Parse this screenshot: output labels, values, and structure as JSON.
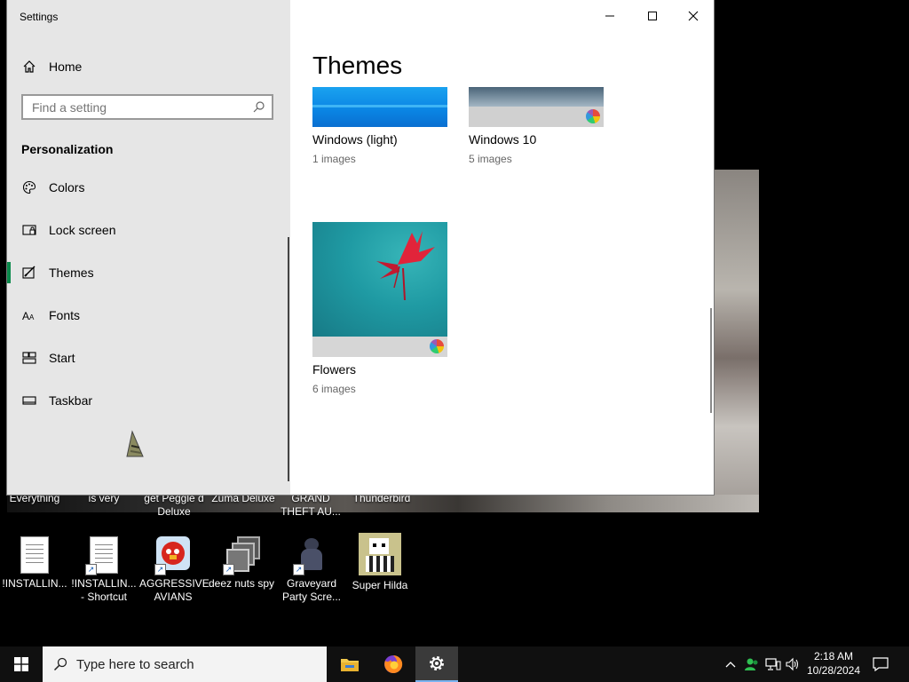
{
  "window": {
    "title": "Settings",
    "heading": "Themes"
  },
  "nav": {
    "home": "Home",
    "search_placeholder": "Find a setting",
    "section": "Personalization",
    "items": [
      {
        "label": "Colors",
        "icon": "palette-icon"
      },
      {
        "label": "Lock screen",
        "icon": "lock-screen-icon"
      },
      {
        "label": "Themes",
        "icon": "themes-icon",
        "active": true
      },
      {
        "label": "Fonts",
        "icon": "fonts-icon"
      },
      {
        "label": "Start",
        "icon": "start-icon"
      },
      {
        "label": "Taskbar",
        "icon": "taskbar-icon"
      }
    ]
  },
  "themes": [
    {
      "name": "Windows (light)",
      "count": "1 images"
    },
    {
      "name": "Windows 10",
      "count": "5 images"
    },
    {
      "name": "Flowers",
      "count": "6 images"
    }
  ],
  "desktop": {
    "partial_labels": [
      "Everything",
      "is very",
      "get Peggle d Deluxe",
      "Zuma Deluxe",
      "GRAND THEFT AU...",
      "Thunderbird"
    ],
    "icons": [
      {
        "label": "!INSTALLIN...",
        "icon": "document-icon"
      },
      {
        "label": "!INSTALLIN... - Shortcut",
        "icon": "document-shortcut-icon"
      },
      {
        "label": "AGGRESSIVE AVIANS",
        "icon": "angry-bird-icon"
      },
      {
        "label": "deez nuts spy",
        "icon": "window-stack-icon"
      },
      {
        "label": "Graveyard Party Scre...",
        "icon": "graveyard-icon"
      },
      {
        "label": "Super Hilda",
        "icon": "pixel-character-icon"
      }
    ]
  },
  "taskbar": {
    "search_placeholder": "Type here to search",
    "time": "2:18 AM",
    "date": "10/28/2024"
  },
  "colors": {
    "accent": "#0a8a4b",
    "taskbar": "#101010",
    "nav_bg": "#e6e6e6"
  }
}
